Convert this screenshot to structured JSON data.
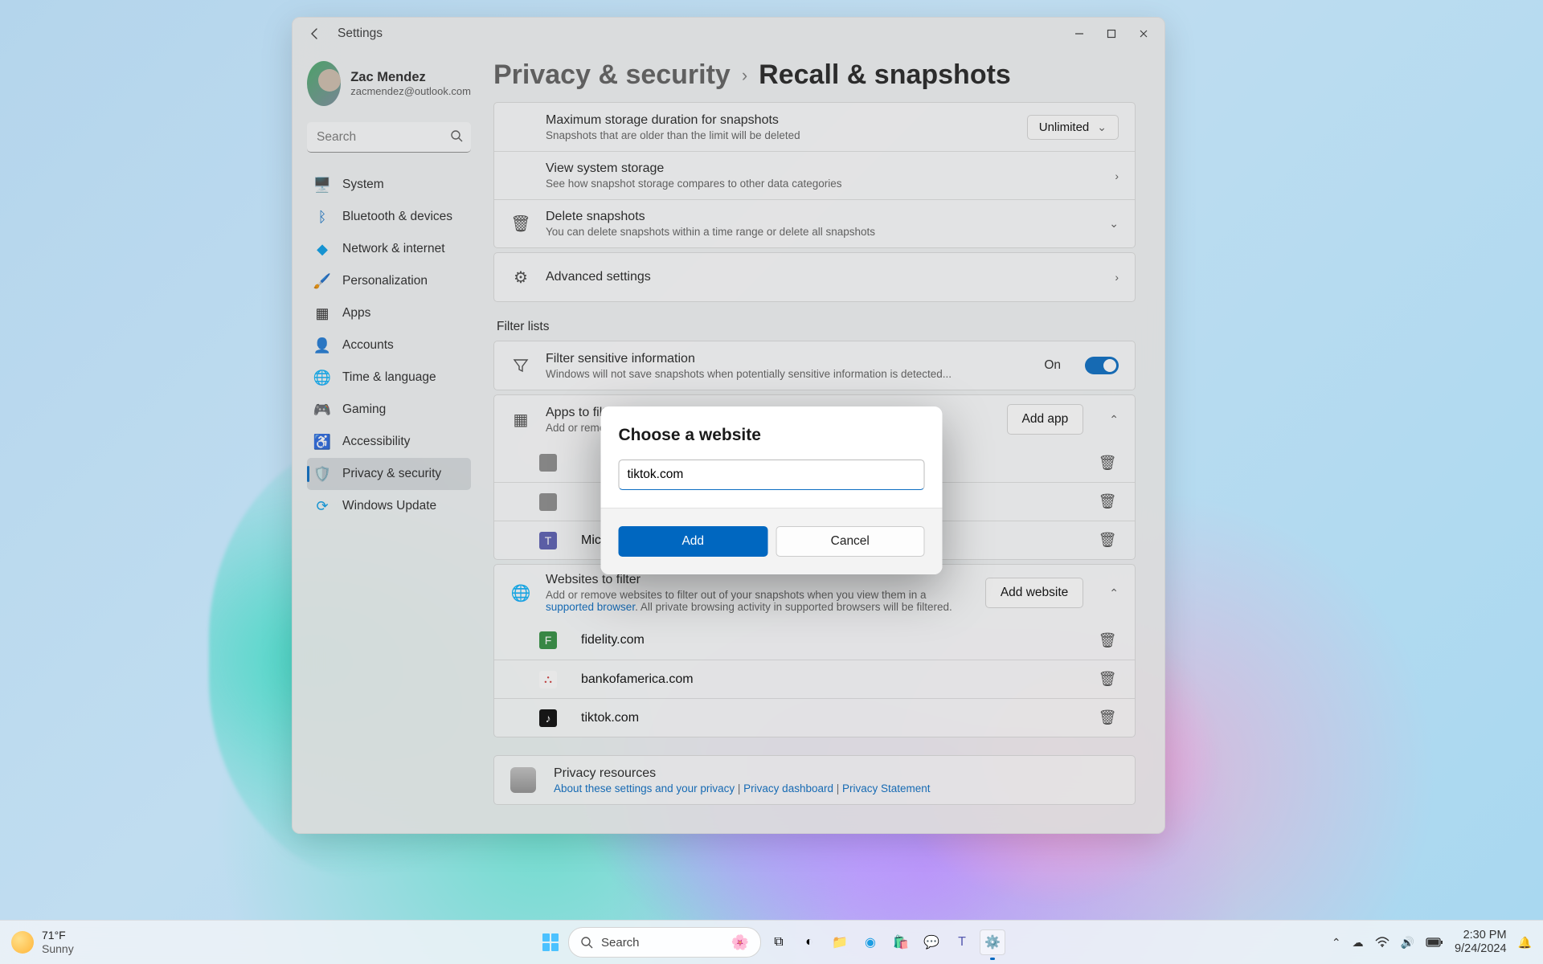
{
  "window": {
    "title": "Settings"
  },
  "user": {
    "name": "Zac Mendez",
    "email": "zacmendez@outlook.com"
  },
  "search": {
    "placeholder": "Search"
  },
  "sidebar": {
    "items": [
      {
        "label": "System"
      },
      {
        "label": "Bluetooth & devices"
      },
      {
        "label": "Network & internet"
      },
      {
        "label": "Personalization"
      },
      {
        "label": "Apps"
      },
      {
        "label": "Accounts"
      },
      {
        "label": "Time & language"
      },
      {
        "label": "Gaming"
      },
      {
        "label": "Accessibility"
      },
      {
        "label": "Privacy & security"
      },
      {
        "label": "Windows Update"
      }
    ]
  },
  "breadcrumb": {
    "parent": "Privacy & security",
    "current": "Recall & snapshots"
  },
  "storage": {
    "max_title": "Maximum storage duration for snapshots",
    "max_desc": "Snapshots that are older than the limit will be deleted",
    "max_value": "Unlimited",
    "view_title": "View system storage",
    "view_desc": "See how snapshot storage compares to other data categories",
    "delete_title": "Delete snapshots",
    "delete_desc": "You can delete snapshots within a time range or delete all snapshots",
    "advanced": "Advanced settings"
  },
  "filter": {
    "heading": "Filter lists",
    "sensitive_title": "Filter sensitive information",
    "sensitive_desc": "Windows will not save snapshots when potentially sensitive information is detected...",
    "toggle_label": "On",
    "apps_title": "Apps to filter",
    "apps_desc": "Add or remove apps to filter out of your snapshots",
    "add_app": "Add app",
    "app3": "Microsoft Teams",
    "sites_title": "Websites to filter",
    "sites_desc1": "Add or remove websites to filter out of your snapshots when you view them in a ",
    "sites_link": "supported browser",
    "sites_desc2": ". All private browsing activity in supported browsers will be filtered.",
    "add_site": "Add website",
    "site1": "fidelity.com",
    "site2": "bankofamerica.com",
    "site3": "tiktok.com"
  },
  "privacy_resources": {
    "title": "Privacy resources",
    "link1": "About these settings and your privacy",
    "link2": "Privacy dashboard",
    "link3": "Privacy Statement"
  },
  "dialog": {
    "title": "Choose a website",
    "value": "tiktok.com",
    "add": "Add",
    "cancel": "Cancel"
  },
  "taskbar": {
    "temp": "71°F",
    "cond": "Sunny",
    "search": "Search",
    "time": "2:30 PM",
    "date": "9/24/2024"
  }
}
